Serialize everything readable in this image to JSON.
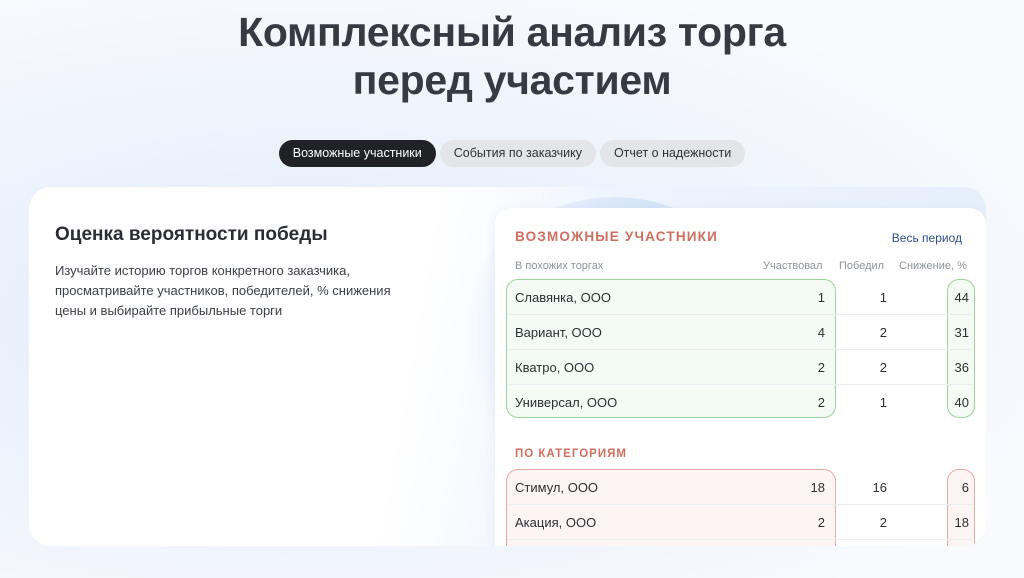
{
  "headline": {
    "line1": "Комплексный анализ торга",
    "line2": "перед участием"
  },
  "tabs": [
    {
      "label": "Возможные участники",
      "active": true
    },
    {
      "label": "События по заказчику",
      "active": false
    },
    {
      "label": "Отчет о надежности",
      "active": false
    }
  ],
  "feature": {
    "title": "Оценка вероятности победы",
    "description": "Изучайте историю торгов конкретного заказчика, просматривайте участников, победителей, % снижения цены и выбирайте прибыльные торги"
  },
  "panel": {
    "title": "ВОЗМОЖНЫЕ УЧАСТНИКИ",
    "period": "Весь период",
    "columns": {
      "group": "В похожих торгах",
      "participated": "Участвовал",
      "won": "Победил",
      "decrease": "Снижение, %"
    },
    "similar_rows": [
      {
        "name": "Славянка, ООО",
        "participated": "1",
        "won": "1",
        "decrease": "44"
      },
      {
        "name": "Вариант, ООО",
        "participated": "4",
        "won": "2",
        "decrease": "31"
      },
      {
        "name": "Кватро, ООО",
        "participated": "2",
        "won": "2",
        "decrease": "36"
      },
      {
        "name": "Универсал, ООО",
        "participated": "2",
        "won": "1",
        "decrease": "40"
      }
    ],
    "category_title": "ПО КАТЕГОРИЯМ",
    "category_rows": [
      {
        "name": "Стимул, ООО",
        "participated": "18",
        "won": "16",
        "decrease": "6"
      },
      {
        "name": "Акация, ООО",
        "participated": "2",
        "won": "2",
        "decrease": "18"
      }
    ]
  },
  "colors": {
    "accent_red": "#cf6f5f",
    "green_border": "#9ad49a",
    "red_border": "#e9aaa0",
    "active_tab": "#202226"
  }
}
